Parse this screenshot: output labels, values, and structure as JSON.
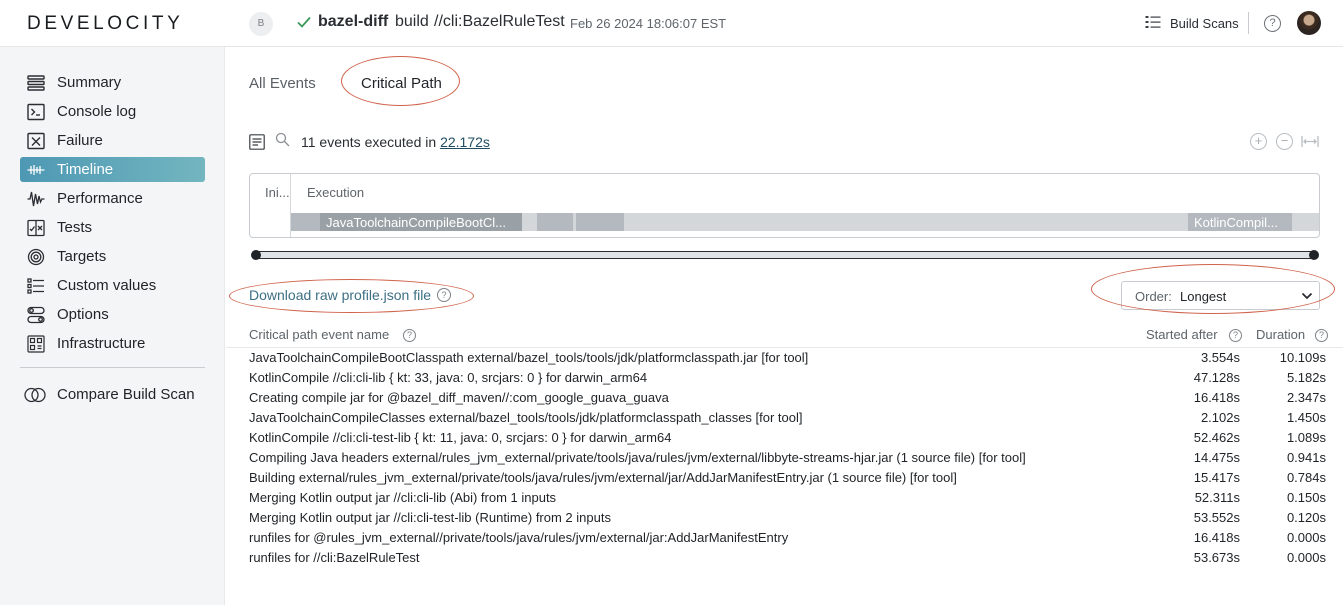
{
  "header": {
    "logo": "DEVELOCITY",
    "project_avatar": "B",
    "project": "bazel-diff",
    "build_word": "build",
    "target": "//cli:BazelRuleTest",
    "date": "Feb 26 2024 18:06:07 EST",
    "build_scans_label": "Build Scans",
    "help": "?"
  },
  "sidebar": {
    "items": [
      {
        "label": "Summary",
        "icon": "summary-icon"
      },
      {
        "label": "Console log",
        "icon": "console-icon"
      },
      {
        "label": "Failure",
        "icon": "failure-icon"
      },
      {
        "label": "Timeline",
        "icon": "timeline-icon"
      },
      {
        "label": "Performance",
        "icon": "performance-icon"
      },
      {
        "label": "Tests",
        "icon": "tests-icon"
      },
      {
        "label": "Targets",
        "icon": "targets-icon"
      },
      {
        "label": "Custom values",
        "icon": "custom-values-icon"
      },
      {
        "label": "Options",
        "icon": "options-icon"
      },
      {
        "label": "Infrastructure",
        "icon": "infrastructure-icon"
      }
    ],
    "compare_label": "Compare Build Scan"
  },
  "tabs": {
    "all": "All Events",
    "critical": "Critical Path"
  },
  "summary": {
    "count": "11 events",
    "executed_in": "executed in",
    "duration": "22.172s"
  },
  "timeline": {
    "ini_label": "Ini...",
    "exec_label": "Execution",
    "seg1": "JavaToolchainCompileBootCl...",
    "seg2": "KotlinCompil..."
  },
  "download_label": "Download raw profile.json file",
  "order": {
    "prefix": "Order:",
    "value": "Longest"
  },
  "table": {
    "col_name": "Critical path event name",
    "col_started": "Started after",
    "col_duration": "Duration",
    "rows": [
      {
        "name": "JavaToolchainCompileBootClasspath external/bazel_tools/tools/jdk/platformclasspath.jar [for tool]",
        "started": "3.554s",
        "duration": "10.109s"
      },
      {
        "name": "KotlinCompile //cli:cli-lib { kt: 33, java: 0, srcjars: 0 } for darwin_arm64",
        "started": "47.128s",
        "duration": "5.182s"
      },
      {
        "name": "Creating compile jar for @bazel_diff_maven//:com_google_guava_guava",
        "started": "16.418s",
        "duration": "2.347s"
      },
      {
        "name": "JavaToolchainCompileClasses external/bazel_tools/tools/jdk/platformclasspath_classes [for tool]",
        "started": "2.102s",
        "duration": "1.450s"
      },
      {
        "name": "KotlinCompile //cli:cli-test-lib { kt: 11, java: 0, srcjars: 0 } for darwin_arm64",
        "started": "52.462s",
        "duration": "1.089s"
      },
      {
        "name": "Compiling Java headers external/rules_jvm_external/private/tools/java/rules/jvm/external/libbyte-streams-hjar.jar (1 source file) [for tool]",
        "started": "14.475s",
        "duration": "0.941s"
      },
      {
        "name": "Building external/rules_jvm_external/private/tools/java/rules/jvm/external/jar/AddJarManifestEntry.jar (1 source file) [for tool]",
        "started": "15.417s",
        "duration": "0.784s"
      },
      {
        "name": "Merging Kotlin output jar //cli:cli-lib (Abi) from 1 inputs",
        "started": "52.311s",
        "duration": "0.150s"
      },
      {
        "name": "Merging Kotlin output jar //cli:cli-test-lib (Runtime) from 2 inputs",
        "started": "53.552s",
        "duration": "0.120s"
      },
      {
        "name": "runfiles for @rules_jvm_external//private/tools/java/rules/jvm/external/jar:AddJarManifestEntry",
        "started": "16.418s",
        "duration": "0.000s"
      },
      {
        "name": "runfiles for //cli:BazelRuleTest",
        "started": "53.673s",
        "duration": "0.000s"
      }
    ]
  },
  "colors": {
    "accent": "#4e98b4",
    "annotation": "#d0644c",
    "link": "#3d6f85"
  }
}
